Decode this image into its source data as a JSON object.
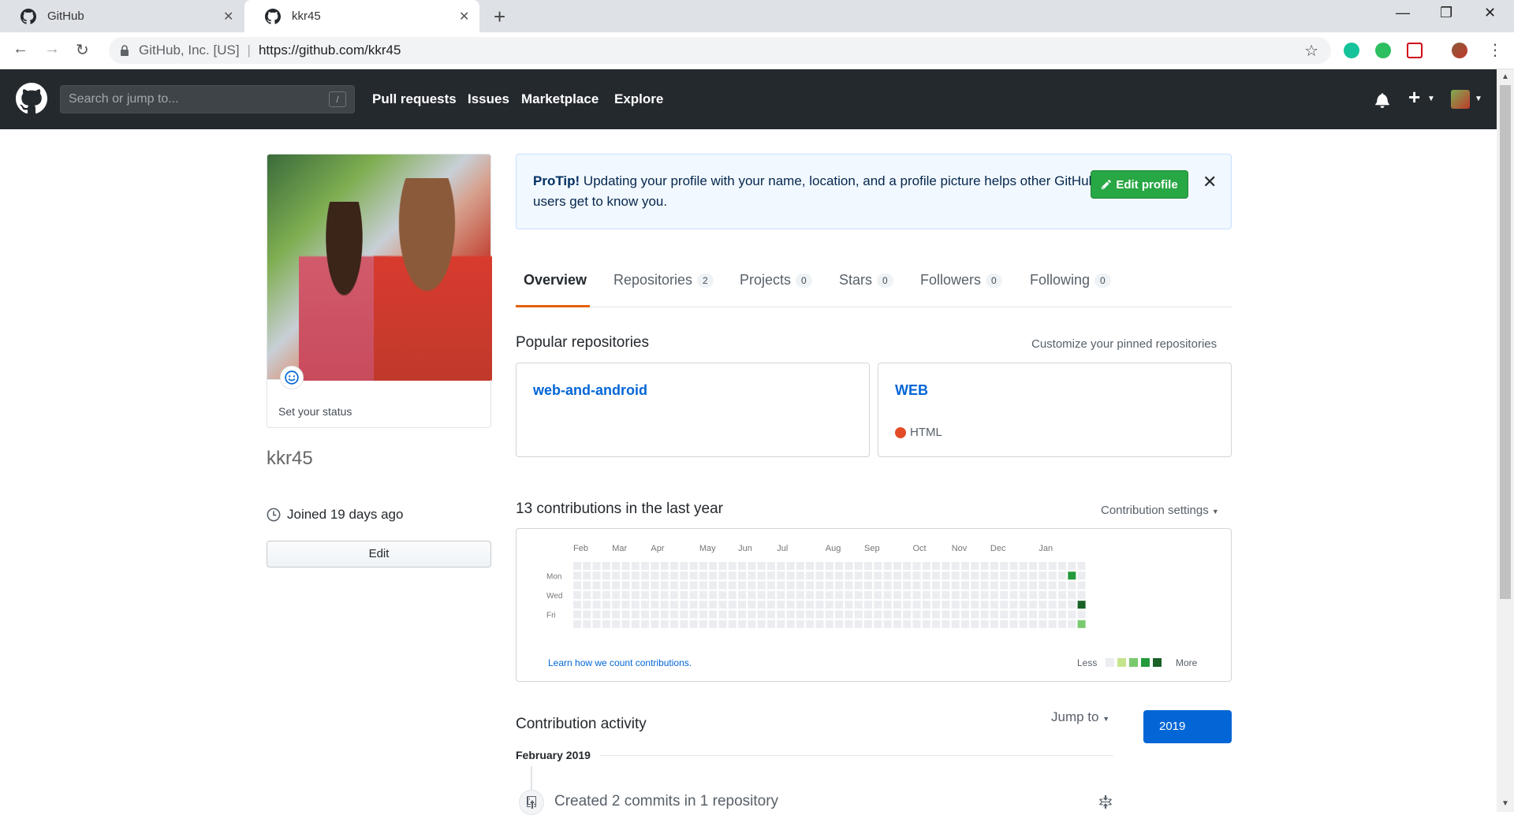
{
  "browser": {
    "tabs": [
      {
        "title": "GitHub",
        "icon": "github-icon"
      },
      {
        "title": "kkr45",
        "icon": "github-icon",
        "active": true
      }
    ],
    "address": {
      "site": "GitHub, Inc. [US]",
      "separator": "|",
      "url": "https://github.com/kkr45"
    }
  },
  "header": {
    "search_placeholder": "Search or jump to...",
    "search_shortcut": "/",
    "nav": [
      "Pull requests",
      "Issues",
      "Marketplace",
      "Explore"
    ]
  },
  "sidebar": {
    "status": "Set your status",
    "username": "kkr45",
    "joined": "Joined 19 days ago",
    "edit_label": "Edit"
  },
  "protip": {
    "lead": "ProTip!",
    "text": " Updating your profile with your name, location, and a profile picture helps other GitHub users get to know you.",
    "button": "Edit profile"
  },
  "tabs": [
    {
      "label": "Overview"
    },
    {
      "label": "Repositories",
      "count": "2"
    },
    {
      "label": "Projects",
      "count": "0"
    },
    {
      "label": "Stars",
      "count": "0"
    },
    {
      "label": "Followers",
      "count": "0"
    },
    {
      "label": "Following",
      "count": "0"
    }
  ],
  "popular": {
    "title": "Popular repositories",
    "customize": "Customize your pinned repositories",
    "repos": [
      {
        "name": "web-and-android",
        "language": ""
      },
      {
        "name": "WEB",
        "language": "HTML",
        "language_color": "#e34c26"
      }
    ]
  },
  "contributions": {
    "title": "13 contributions in the last year",
    "settings": "Contribution settings",
    "months": [
      "Feb",
      "Mar",
      "Apr",
      "May",
      "Jun",
      "Jul",
      "Aug",
      "Sep",
      "Oct",
      "Nov",
      "Dec",
      "Jan"
    ],
    "days": [
      "Mon",
      "Wed",
      "Fri"
    ],
    "learn": "Learn how we count contributions.",
    "less": "Less",
    "more": "More",
    "colors": [
      "#ebedf0",
      "#c6e48b",
      "#7bc96f",
      "#239a3b",
      "#196127"
    ],
    "active_cells": [
      {
        "week": 51,
        "day": 1,
        "level": 3
      },
      {
        "week": 52,
        "day": 4,
        "level": 4
      },
      {
        "week": 52,
        "day": 6,
        "level": 2
      }
    ]
  },
  "activity": {
    "title": "Contribution activity",
    "jump": "Jump to",
    "year": "2019",
    "month": "February 2019",
    "summary": "Created 2 commits in 1 repository"
  }
}
